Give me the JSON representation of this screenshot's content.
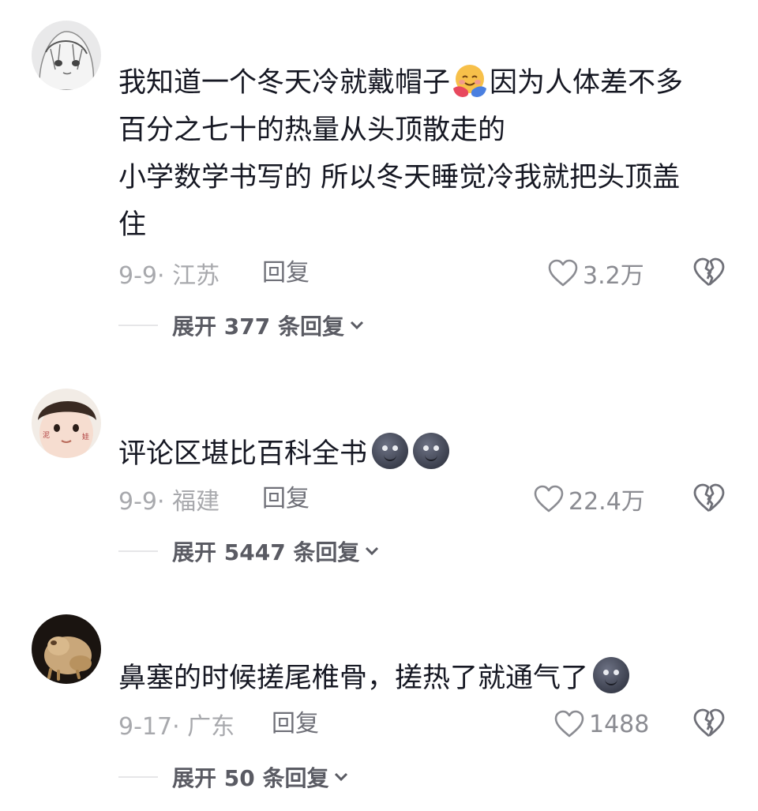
{
  "comments": [
    {
      "lines": [
        "我知道一个冬天冷就戴帽子",
        "因为人体差不多",
        "百分之七十的热量从头顶散走的",
        "小学数学书写的 所以冬天睡觉冷我就把头顶盖",
        "住"
      ],
      "date_location": "9-9· 江苏",
      "reply_label": "回复",
      "likes": "3.2万",
      "expand_label": "展开 377 条回复"
    },
    {
      "lines": [
        "评论区堪比百科全书"
      ],
      "date_location": "9-9· 福建",
      "reply_label": "回复",
      "likes": "22.4万",
      "expand_label": "展开 5447 条回复"
    },
    {
      "lines": [
        "鼻塞的时候搓尾椎骨，搓热了就通气了"
      ],
      "date_location": "9-17· 广东",
      "reply_label": "回复",
      "likes": "1488",
      "expand_label": "展开 50 条回复"
    }
  ],
  "icons": {
    "like": "heart-outline-icon",
    "dislike": "broken-heart-icon",
    "expand": "chevron-down-icon",
    "emoji_hug": "hugging-face-emoji",
    "emoji_moon": "new-moon-face-emoji"
  },
  "colors": {
    "text": "#161823",
    "meta": "#a8a9ad",
    "reply": "#6f7078",
    "expand": "#5a5b63"
  }
}
